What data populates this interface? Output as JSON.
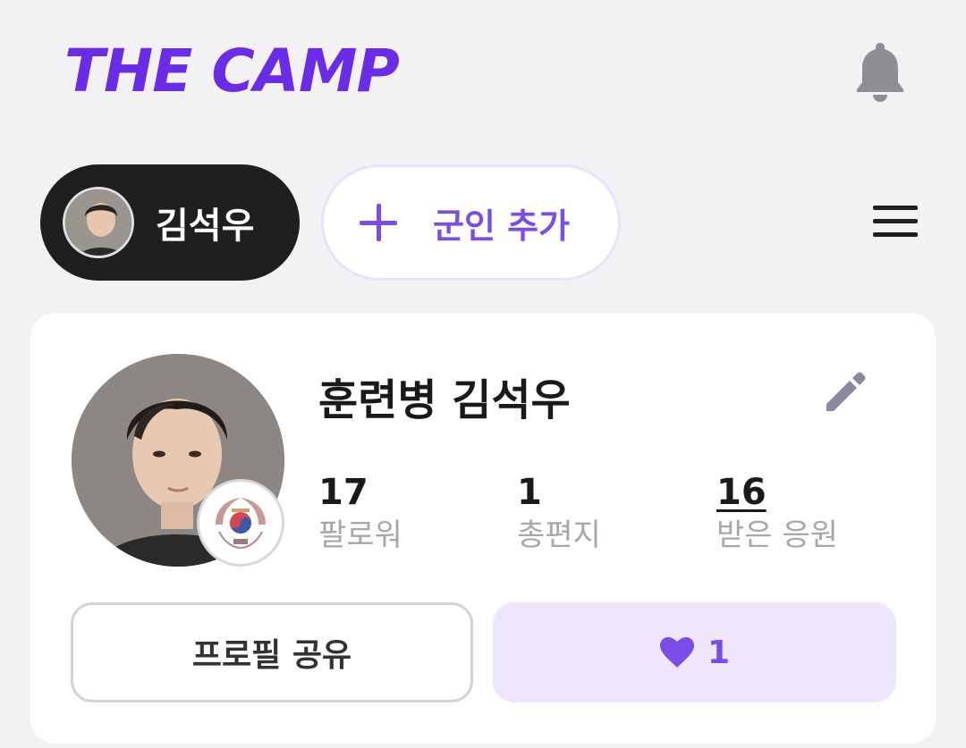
{
  "header": {
    "logo": "THE CAMP",
    "notification_icon": "bell-icon"
  },
  "soldier_tabs": {
    "active_soldier": "김석우",
    "add_button": "군인 추가",
    "menu_icon": "hamburger-menu-icon"
  },
  "profile": {
    "name": "훈련병 김석우",
    "edit_icon": "pencil-icon",
    "stats": [
      {
        "value": "17",
        "label": "팔로워"
      },
      {
        "value": "1",
        "label": "총편지"
      },
      {
        "value": "16",
        "label": "받은 응원"
      }
    ],
    "share_button": "프로필 공유",
    "cheer_count": "1"
  },
  "colors": {
    "brand": "#6a2ce6",
    "accent": "#7c4ce8",
    "accent_light": "#ede6fd",
    "dark_chip": "#1f1f1f"
  }
}
